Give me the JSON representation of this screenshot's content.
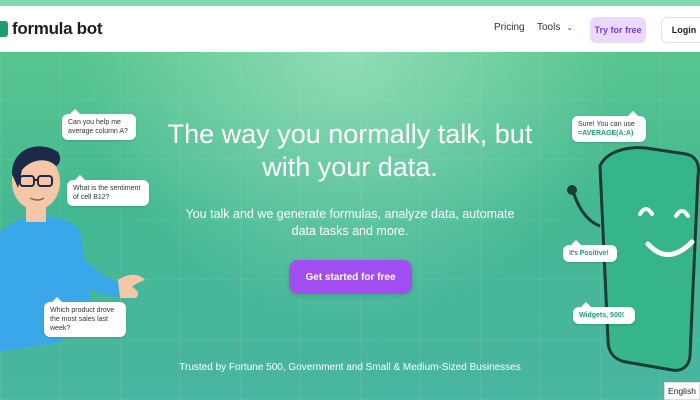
{
  "nav": {
    "logo_text": "formula bot",
    "links": [
      "Pricing",
      "Tools"
    ],
    "try_label": "Try for free",
    "login_label": "Login"
  },
  "hero": {
    "headline": "The way you normally talk, but with your data.",
    "subhead": "You talk and we generate formulas, analyze data, automate data tasks and more.",
    "cta_label": "Get started for free",
    "trusted": "Trusted by Fortune 500, Government and Small & Medium-Sized Businesses"
  },
  "bubbles": {
    "q1": "Can you help me average column A?",
    "q2": "What is the sentiment of cell B12?",
    "q3": "Which product drove the most sales last week?",
    "a1_text": "Sure! You can use",
    "a1_formula": "=AVERAGE(A:A)",
    "a2_prefix": "It's ",
    "a2_highlight": "Positive!",
    "a3": "Widgets, 500!"
  },
  "footer": {
    "language": "English"
  },
  "colors": {
    "brand": "#1f9d72",
    "cta": "#a24df0",
    "try_bg": "#ead9fb",
    "hero_green": "#44b892"
  }
}
